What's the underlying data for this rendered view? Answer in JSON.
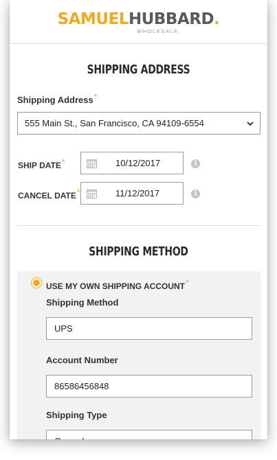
{
  "brand": {
    "name_part1": "SAMUEL",
    "name_part2": "HUBBARD",
    "name_dot": ".",
    "subtitle": "WHOLESALE",
    "accent_color": "#f2a922",
    "text_color": "#5a5a5a"
  },
  "shipping_address_section": {
    "title": "SHIPPING ADDRESS",
    "address_label": "Shipping Address",
    "required_marker": "*",
    "address_value": "555 Main St., San Francisco, CA 94109-6554",
    "ship_date_label": "SHIP DATE",
    "ship_date_value": "10/12/2017",
    "cancel_date_label": "CANCEL DATE",
    "cancel_date_value": "11/12/2017",
    "info_glyph": "i"
  },
  "shipping_method_section": {
    "title": "SHIPPING METHOD",
    "option_label": "USE MY OWN SHIPPING ACCOUNT",
    "option_selected": true,
    "method_label": "Shipping Method",
    "method_value": "UPS",
    "account_label": "Account Number",
    "account_value": "86586456848",
    "type_label": "Shipping Type",
    "type_value": "Ground"
  }
}
